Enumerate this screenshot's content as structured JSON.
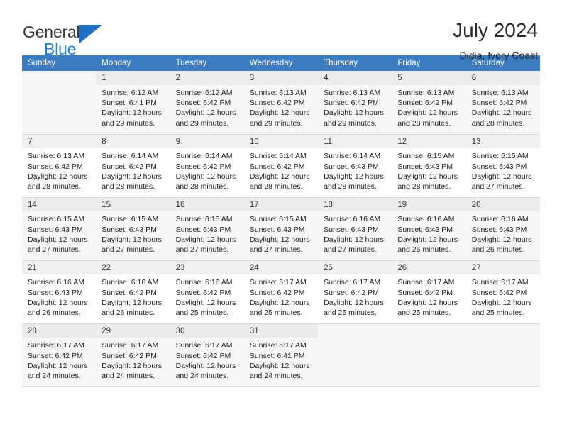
{
  "brand": {
    "name_top": "General",
    "name_bottom": "Blue",
    "triangle_color": "#1f6fc4",
    "blue_color": "#1f84d8"
  },
  "header": {
    "title": "July 2024",
    "subtitle": "Didia, Ivory Coast"
  },
  "theme": {
    "header_row_bg": "#3b7dc0",
    "header_row_text": "#ffffff",
    "daynum_bg": "#f0f0f0",
    "row_shade_bg": "#f7f7f7",
    "grid_line": "#d9d9d9"
  },
  "weekdays": [
    "Sunday",
    "Monday",
    "Tuesday",
    "Wednesday",
    "Thursday",
    "Friday",
    "Saturday"
  ],
  "labels": {
    "sunrise_prefix": "Sunrise:",
    "sunset_prefix": "Sunset:",
    "daylight_prefix": "Daylight:"
  },
  "weeks": [
    [
      {
        "day": "",
        "sunrise": "",
        "sunset": "",
        "daylight_line1": "",
        "daylight_line2": ""
      },
      {
        "day": "1",
        "sunrise": "Sunrise: 6:12 AM",
        "sunset": "Sunset: 6:41 PM",
        "daylight_line1": "Daylight: 12 hours",
        "daylight_line2": "and 29 minutes."
      },
      {
        "day": "2",
        "sunrise": "Sunrise: 6:12 AM",
        "sunset": "Sunset: 6:42 PM",
        "daylight_line1": "Daylight: 12 hours",
        "daylight_line2": "and 29 minutes."
      },
      {
        "day": "3",
        "sunrise": "Sunrise: 6:13 AM",
        "sunset": "Sunset: 6:42 PM",
        "daylight_line1": "Daylight: 12 hours",
        "daylight_line2": "and 29 minutes."
      },
      {
        "day": "4",
        "sunrise": "Sunrise: 6:13 AM",
        "sunset": "Sunset: 6:42 PM",
        "daylight_line1": "Daylight: 12 hours",
        "daylight_line2": "and 29 minutes."
      },
      {
        "day": "5",
        "sunrise": "Sunrise: 6:13 AM",
        "sunset": "Sunset: 6:42 PM",
        "daylight_line1": "Daylight: 12 hours",
        "daylight_line2": "and 28 minutes."
      },
      {
        "day": "6",
        "sunrise": "Sunrise: 6:13 AM",
        "sunset": "Sunset: 6:42 PM",
        "daylight_line1": "Daylight: 12 hours",
        "daylight_line2": "and 28 minutes."
      }
    ],
    [
      {
        "day": "7",
        "sunrise": "Sunrise: 6:13 AM",
        "sunset": "Sunset: 6:42 PM",
        "daylight_line1": "Daylight: 12 hours",
        "daylight_line2": "and 28 minutes."
      },
      {
        "day": "8",
        "sunrise": "Sunrise: 6:14 AM",
        "sunset": "Sunset: 6:42 PM",
        "daylight_line1": "Daylight: 12 hours",
        "daylight_line2": "and 28 minutes."
      },
      {
        "day": "9",
        "sunrise": "Sunrise: 6:14 AM",
        "sunset": "Sunset: 6:42 PM",
        "daylight_line1": "Daylight: 12 hours",
        "daylight_line2": "and 28 minutes."
      },
      {
        "day": "10",
        "sunrise": "Sunrise: 6:14 AM",
        "sunset": "Sunset: 6:42 PM",
        "daylight_line1": "Daylight: 12 hours",
        "daylight_line2": "and 28 minutes."
      },
      {
        "day": "11",
        "sunrise": "Sunrise: 6:14 AM",
        "sunset": "Sunset: 6:43 PM",
        "daylight_line1": "Daylight: 12 hours",
        "daylight_line2": "and 28 minutes."
      },
      {
        "day": "12",
        "sunrise": "Sunrise: 6:15 AM",
        "sunset": "Sunset: 6:43 PM",
        "daylight_line1": "Daylight: 12 hours",
        "daylight_line2": "and 28 minutes."
      },
      {
        "day": "13",
        "sunrise": "Sunrise: 6:15 AM",
        "sunset": "Sunset: 6:43 PM",
        "daylight_line1": "Daylight: 12 hours",
        "daylight_line2": "and 27 minutes."
      }
    ],
    [
      {
        "day": "14",
        "sunrise": "Sunrise: 6:15 AM",
        "sunset": "Sunset: 6:43 PM",
        "daylight_line1": "Daylight: 12 hours",
        "daylight_line2": "and 27 minutes."
      },
      {
        "day": "15",
        "sunrise": "Sunrise: 6:15 AM",
        "sunset": "Sunset: 6:43 PM",
        "daylight_line1": "Daylight: 12 hours",
        "daylight_line2": "and 27 minutes."
      },
      {
        "day": "16",
        "sunrise": "Sunrise: 6:15 AM",
        "sunset": "Sunset: 6:43 PM",
        "daylight_line1": "Daylight: 12 hours",
        "daylight_line2": "and 27 minutes."
      },
      {
        "day": "17",
        "sunrise": "Sunrise: 6:15 AM",
        "sunset": "Sunset: 6:43 PM",
        "daylight_line1": "Daylight: 12 hours",
        "daylight_line2": "and 27 minutes."
      },
      {
        "day": "18",
        "sunrise": "Sunrise: 6:16 AM",
        "sunset": "Sunset: 6:43 PM",
        "daylight_line1": "Daylight: 12 hours",
        "daylight_line2": "and 27 minutes."
      },
      {
        "day": "19",
        "sunrise": "Sunrise: 6:16 AM",
        "sunset": "Sunset: 6:43 PM",
        "daylight_line1": "Daylight: 12 hours",
        "daylight_line2": "and 26 minutes."
      },
      {
        "day": "20",
        "sunrise": "Sunrise: 6:16 AM",
        "sunset": "Sunset: 6:43 PM",
        "daylight_line1": "Daylight: 12 hours",
        "daylight_line2": "and 26 minutes."
      }
    ],
    [
      {
        "day": "21",
        "sunrise": "Sunrise: 6:16 AM",
        "sunset": "Sunset: 6:43 PM",
        "daylight_line1": "Daylight: 12 hours",
        "daylight_line2": "and 26 minutes."
      },
      {
        "day": "22",
        "sunrise": "Sunrise: 6:16 AM",
        "sunset": "Sunset: 6:42 PM",
        "daylight_line1": "Daylight: 12 hours",
        "daylight_line2": "and 26 minutes."
      },
      {
        "day": "23",
        "sunrise": "Sunrise: 6:16 AM",
        "sunset": "Sunset: 6:42 PM",
        "daylight_line1": "Daylight: 12 hours",
        "daylight_line2": "and 25 minutes."
      },
      {
        "day": "24",
        "sunrise": "Sunrise: 6:17 AM",
        "sunset": "Sunset: 6:42 PM",
        "daylight_line1": "Daylight: 12 hours",
        "daylight_line2": "and 25 minutes."
      },
      {
        "day": "25",
        "sunrise": "Sunrise: 6:17 AM",
        "sunset": "Sunset: 6:42 PM",
        "daylight_line1": "Daylight: 12 hours",
        "daylight_line2": "and 25 minutes."
      },
      {
        "day": "26",
        "sunrise": "Sunrise: 6:17 AM",
        "sunset": "Sunset: 6:42 PM",
        "daylight_line1": "Daylight: 12 hours",
        "daylight_line2": "and 25 minutes."
      },
      {
        "day": "27",
        "sunrise": "Sunrise: 6:17 AM",
        "sunset": "Sunset: 6:42 PM",
        "daylight_line1": "Daylight: 12 hours",
        "daylight_line2": "and 25 minutes."
      }
    ],
    [
      {
        "day": "28",
        "sunrise": "Sunrise: 6:17 AM",
        "sunset": "Sunset: 6:42 PM",
        "daylight_line1": "Daylight: 12 hours",
        "daylight_line2": "and 24 minutes."
      },
      {
        "day": "29",
        "sunrise": "Sunrise: 6:17 AM",
        "sunset": "Sunset: 6:42 PM",
        "daylight_line1": "Daylight: 12 hours",
        "daylight_line2": "and 24 minutes."
      },
      {
        "day": "30",
        "sunrise": "Sunrise: 6:17 AM",
        "sunset": "Sunset: 6:42 PM",
        "daylight_line1": "Daylight: 12 hours",
        "daylight_line2": "and 24 minutes."
      },
      {
        "day": "31",
        "sunrise": "Sunrise: 6:17 AM",
        "sunset": "Sunset: 6:41 PM",
        "daylight_line1": "Daylight: 12 hours",
        "daylight_line2": "and 24 minutes."
      },
      {
        "day": "",
        "sunrise": "",
        "sunset": "",
        "daylight_line1": "",
        "daylight_line2": ""
      },
      {
        "day": "",
        "sunrise": "",
        "sunset": "",
        "daylight_line1": "",
        "daylight_line2": ""
      },
      {
        "day": "",
        "sunrise": "",
        "sunset": "",
        "daylight_line1": "",
        "daylight_line2": ""
      }
    ]
  ]
}
